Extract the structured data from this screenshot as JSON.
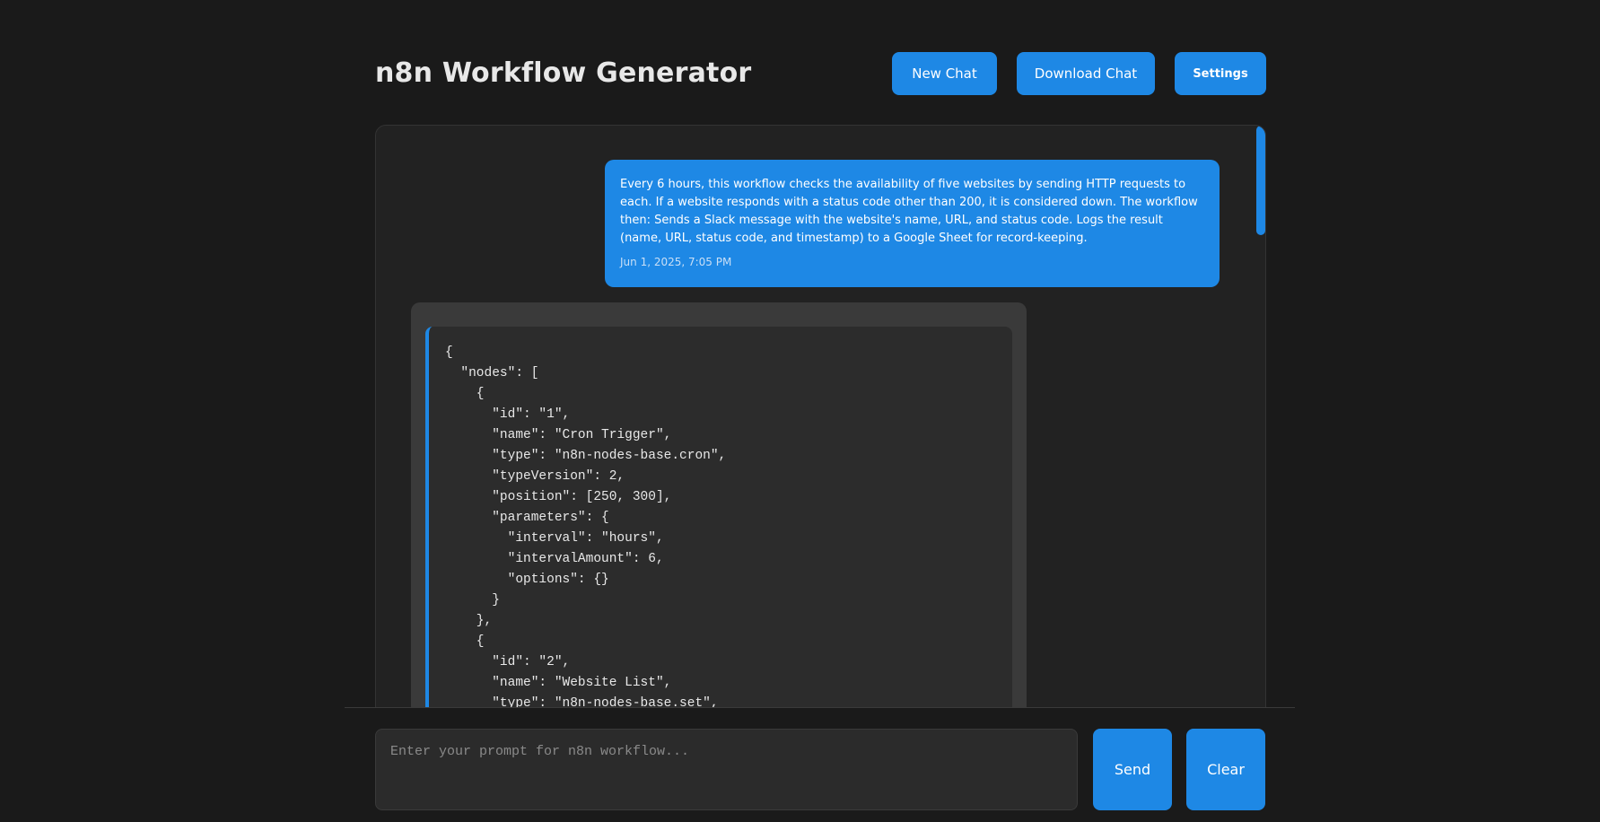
{
  "header": {
    "title": "n8n Workflow Generator",
    "new_chat_label": "New Chat",
    "download_chat_label": "Download Chat",
    "settings_label": "Settings"
  },
  "messages": {
    "user": {
      "text": "Every 6 hours, this workflow checks the availability of five websites by sending HTTP requests to each. If a website responds with a status code other than 200, it is considered down. The workflow then: Sends a Slack message with the website's name, URL, and status code. Logs the result (name, URL, status code, and timestamp) to a Google Sheet for record-keeping.",
      "timestamp": "Jun 1, 2025, 7:05 PM"
    },
    "assistant": {
      "code_lines": [
        "{",
        "  \"nodes\": [",
        "    {",
        "      \"id\": \"1\",",
        "      \"name\": \"Cron Trigger\",",
        "      \"type\": \"n8n-nodes-base.cron\",",
        "      \"typeVersion\": 2,",
        "      \"position\": [250, 300],",
        "      \"parameters\": {",
        "        \"interval\": \"hours\",",
        "        \"intervalAmount\": 6,",
        "        \"options\": {}",
        "      }",
        "    },",
        "    {",
        "      \"id\": \"2\",",
        "      \"name\": \"Website List\",",
        "      \"type\": \"n8n-nodes-base.set\","
      ]
    }
  },
  "input": {
    "placeholder": "Enter your prompt for n8n workflow...",
    "value": ""
  },
  "actions": {
    "send_label": "Send",
    "clear_label": "Clear"
  },
  "colors": {
    "accent": "#1e88e5",
    "background": "#1a1a1a",
    "panel": "#222222",
    "code_bg": "#2c2c2c"
  }
}
